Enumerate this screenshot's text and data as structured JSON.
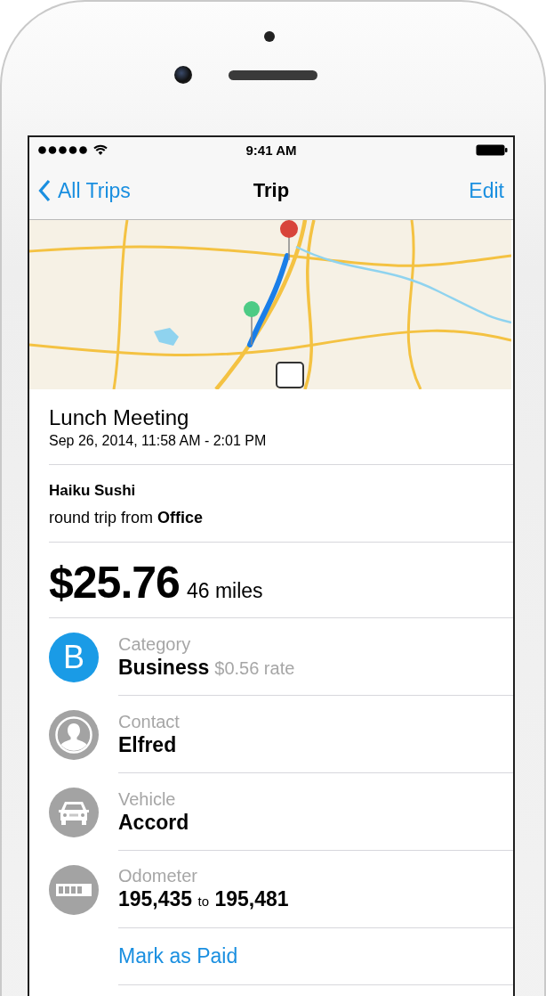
{
  "status_bar": {
    "time": "9:41 AM"
  },
  "nav": {
    "back": "All Trips",
    "title": "Trip",
    "action": "Edit"
  },
  "trip": {
    "title": "Lunch Meeting",
    "time_range": "Sep 26, 2014, 11:58 AM - 2:01 PM"
  },
  "place": {
    "name": "Haiku Sushi",
    "description": "round trip from **Office**"
  },
  "amount": {
    "value": "$25.76",
    "distance": "46 miles"
  },
  "details": [
    {
      "kind": "letter",
      "badge": "B",
      "color": "#1a9be6",
      "label": "Category",
      "value": "Business",
      "note": "$0.56 rate"
    },
    {
      "kind": "contact",
      "color": "#a3a3a3",
      "label": "Contact",
      "value": "Elfred"
    },
    {
      "kind": "vehicle",
      "color": "#a3a3a3",
      "label": "Vehicle",
      "value": "Accord"
    },
    {
      "kind": "odometer",
      "color": "#a3a3a3",
      "label": "Odometer",
      "value": "195,435",
      "joiner": "to",
      "value_end": "195,481"
    }
  ],
  "action": "Mark as Paid"
}
